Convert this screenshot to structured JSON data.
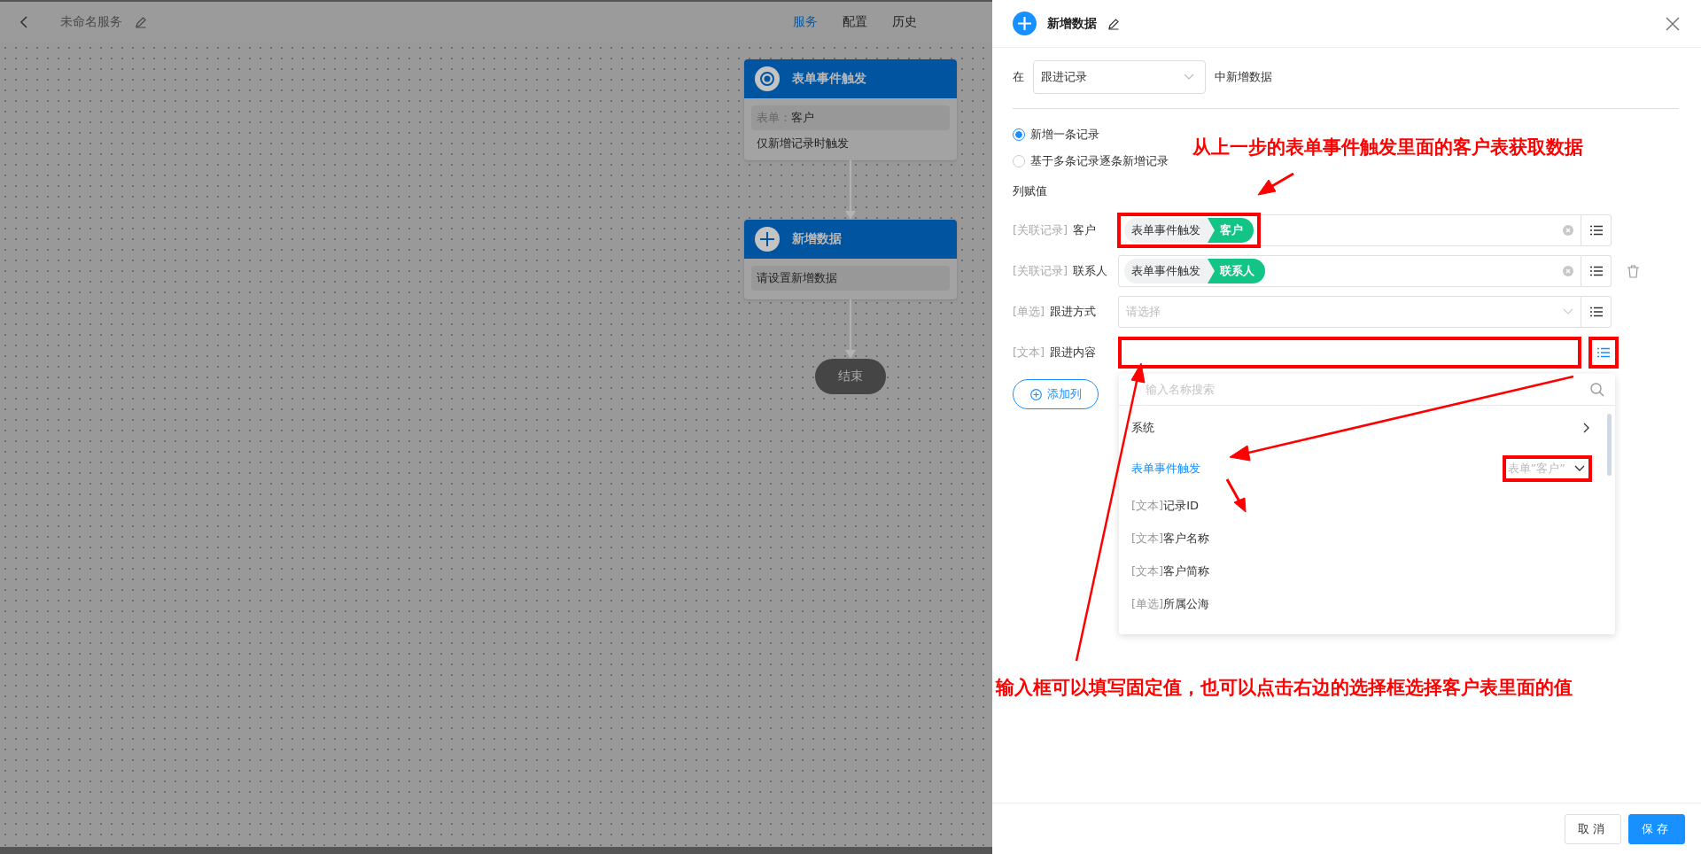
{
  "editor": {
    "title": "未命名服务",
    "tabs": [
      {
        "label": "服务",
        "selected": true
      },
      {
        "label": "配置",
        "selected": false
      },
      {
        "label": "历史",
        "selected": false
      }
    ]
  },
  "flow": {
    "nodes": [
      {
        "kind": "trigger",
        "title": "表单事件触发",
        "box_label": "表单：",
        "box_value": "客户",
        "note": "仅新增记录时触发"
      },
      {
        "kind": "add",
        "title": "新增数据",
        "box_value": "请设置新增数据"
      }
    ],
    "end_label": "结束"
  },
  "panel": {
    "title": "新增数据",
    "prefix": "在",
    "table": "跟进记录",
    "suffix": "中新增数据",
    "modes": [
      {
        "label": "新增一条记录",
        "selected": true
      },
      {
        "label": "基于多条记录逐条新增记录",
        "selected": false
      }
    ],
    "section": "列赋值",
    "fields": [
      {
        "tag": "[关联记录]",
        "name": "客户",
        "kind": "chips",
        "source": "表单事件触发",
        "field": "客户",
        "highlighted": true,
        "button_highlighted": false,
        "deletable": false
      },
      {
        "tag": "[关联记录]",
        "name": "联系人",
        "kind": "chips",
        "source": "表单事件触发",
        "field": "联系人",
        "highlighted": false,
        "button_highlighted": false,
        "deletable": true
      },
      {
        "tag": "[单选]",
        "name": "跟进方式",
        "kind": "select",
        "placeholder": "请选择",
        "highlighted": false,
        "button_highlighted": false,
        "deletable": false
      },
      {
        "tag": "[文本]",
        "name": "跟进内容",
        "kind": "text",
        "highlighted": true,
        "button_highlighted": true,
        "deletable": false
      }
    ],
    "add_column": "添加列",
    "picker": {
      "placeholder": "输入名称搜索",
      "items": [
        {
          "kind": "group",
          "label": "系统",
          "expanded": false,
          "selected": false
        },
        {
          "kind": "group",
          "label": "表单事件触发",
          "expanded": true,
          "selected": true,
          "scope": "表单”客户”",
          "scope_highlighted": true
        },
        {
          "kind": "field",
          "tag": "[文本]",
          "label": "记录ID"
        },
        {
          "kind": "field",
          "tag": "[文本]",
          "label": "客户名称"
        },
        {
          "kind": "field",
          "tag": "[文本]",
          "label": "客户简称"
        },
        {
          "kind": "field",
          "tag": "[单选]",
          "label": "所属公海"
        }
      ]
    },
    "buttons": [
      {
        "label": "取消",
        "kind": "secondary"
      },
      {
        "label": "保存",
        "kind": "primary"
      }
    ]
  },
  "annotations": [
    "从上一步的表单事件触发里面的客户表获取数据",
    "输入框可以填写固定值，也可以点击右边的选择框选择客户表里面的值"
  ]
}
